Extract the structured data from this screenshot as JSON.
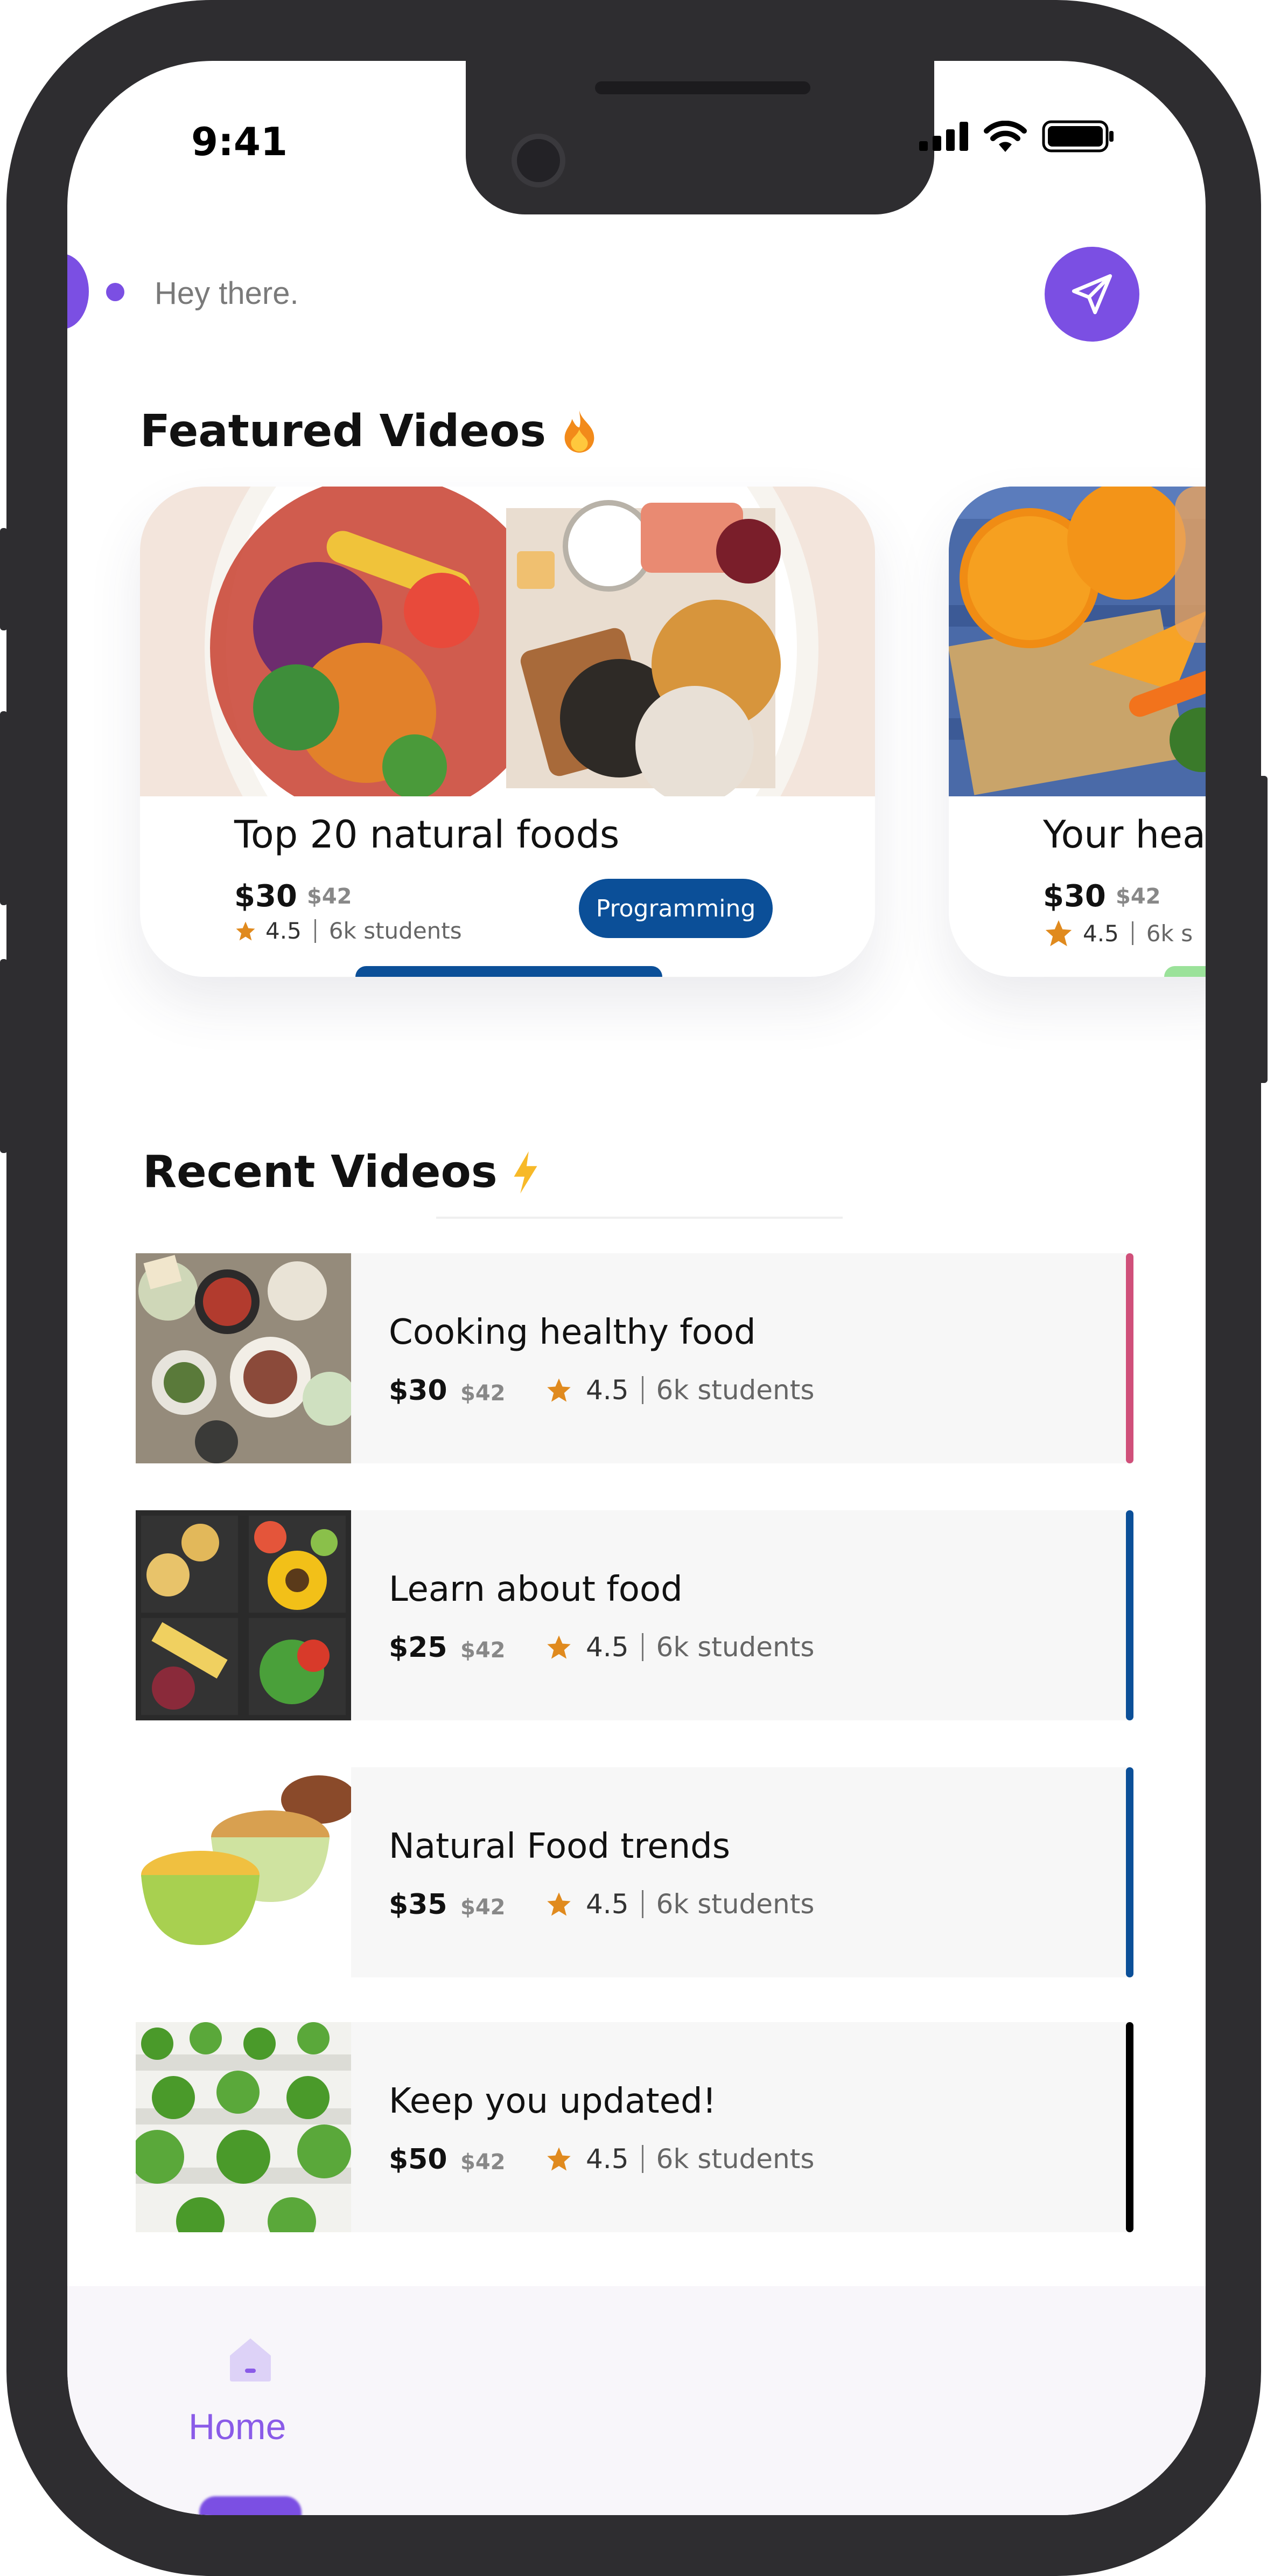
{
  "status_bar": {
    "time": "9:41"
  },
  "chat": {
    "placeholder": "Hey there."
  },
  "featured": {
    "title": "Featured Videos",
    "cards": [
      {
        "title": "Top 20 natural foods",
        "price": "$30",
        "old_price": "$42",
        "rating": "4.5",
        "students": "6k students",
        "tag": "Programming"
      },
      {
        "title": "Your hea",
        "price": "$30",
        "old_price": "$42",
        "rating": "4.5",
        "students": "6k s"
      }
    ]
  },
  "recent": {
    "title": "Recent Videos",
    "items": [
      {
        "title": "Cooking healthy food",
        "price": "$30",
        "old_price": "$42",
        "rating": "4.5",
        "students": "6k students",
        "accent": "#d0507a"
      },
      {
        "title": "Learn about food",
        "price": "$25",
        "old_price": "$42",
        "rating": "4.5",
        "students": "6k students",
        "accent": "#0b4f98"
      },
      {
        "title": "Natural Food trends",
        "price": "$35",
        "old_price": "$42",
        "rating": "4.5",
        "students": "6k students",
        "accent": "#0b4f98"
      },
      {
        "title": "Keep you updated!",
        "price": "$50",
        "old_price": "$42",
        "rating": "4.5",
        "students": "6k students",
        "accent": "#000000"
      }
    ]
  },
  "nav": {
    "home_label": "Home"
  },
  "colors": {
    "accent": "#7b4fe3",
    "tag": "#0b4f98",
    "star": "#e08a1e"
  }
}
